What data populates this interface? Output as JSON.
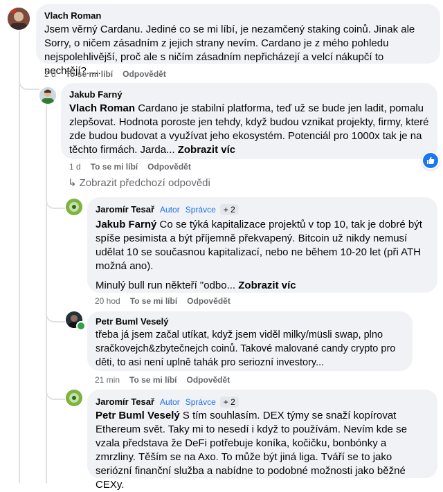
{
  "comments": [
    {
      "author": "Vlach Roman",
      "text": "Jsem věrný Cardanu. Jediné co se mi líbí, je nezamčený staking coinů. Jinak ale Sorry, o ničem zásadním z jejich strany nevím. Cardano je z mého pohledu nejspolehlivější, proč ale s ničím zásadním nepřicházejí a velcí nákupčí to nechtějí?.....",
      "age": "2 d",
      "like": "To se mi líbí",
      "reply": "Odpovědět"
    },
    {
      "author": "Jakub Farný",
      "mention": "Vlach Roman",
      "text": " Cardano je stabilní platforma, teď už se bude jen ladit, pomalu zlepšovat. Hodnota poroste jen tehdy, když budou vznikat projekty, firmy, které zde budou budovat a využívat jeho ekosystém. Potenciál pro 1000x tak je na těchto firmách. Jarda... ",
      "more": "Zobrazit víc",
      "age": "1 d",
      "like": "To se mi líbí",
      "reply": "Odpovědět"
    },
    {
      "author": "Jaromír Tesař",
      "badge1": "Autor",
      "badge2": "Správce",
      "extra": "+ 2",
      "mention": "Jakub Farný",
      "text": " Co se týká kapitalizace projektů v top 10, tak je dobré být spíše pesimista a být příjemně překvapený. Bitcoin už nikdy nemusí udělat 10 se současnou kapitalizací, nebo ne během 10-20 let (při ATH možná ano).",
      "text2": "Minulý bull run někteří \"odbo... ",
      "more": "Zobrazit víc",
      "age": "20 hod",
      "like": "To se mi líbí",
      "reply": "Odpovědět"
    },
    {
      "author": "Petr Buml Veselý",
      "text": "třeba já jsem začal utíkat, když jsem viděl milky/müsli swap, plno sračkovejch&zbytečnejch coinů. Takové malované candy crypto pro děti, to asi není uplně tahák pro seriozní investory...",
      "age": "21 min",
      "like": "To se mi líbí",
      "reply": "Odpovědět"
    },
    {
      "author": "Jaromír Tesař",
      "badge1": "Autor",
      "badge2": "Správce",
      "extra": "+ 2",
      "mention": "Petr Buml Veselý",
      "text": " S tím souhlasím. DEX týmy se snaží kopírovat Ethereum svět. Taky mi to nesedí i když to používám. Nevím kde se vzala představa že DeFi potřebuje koníka, kočičku, bonbónky a zmrzliny. Těším se na Axo. To může být jiná liga. Tváří se to jako seriózní finanční služba a nabídne to podobné možnosti jako běžné CEXy."
    }
  ],
  "show_previous": "Zobrazit předchozí odpovědi",
  "colors": {
    "bubble": "#f0f2f5",
    "meta": "#65676b",
    "badge": "#1a73e8",
    "like": "#1877f2",
    "online": "#31a24c"
  }
}
